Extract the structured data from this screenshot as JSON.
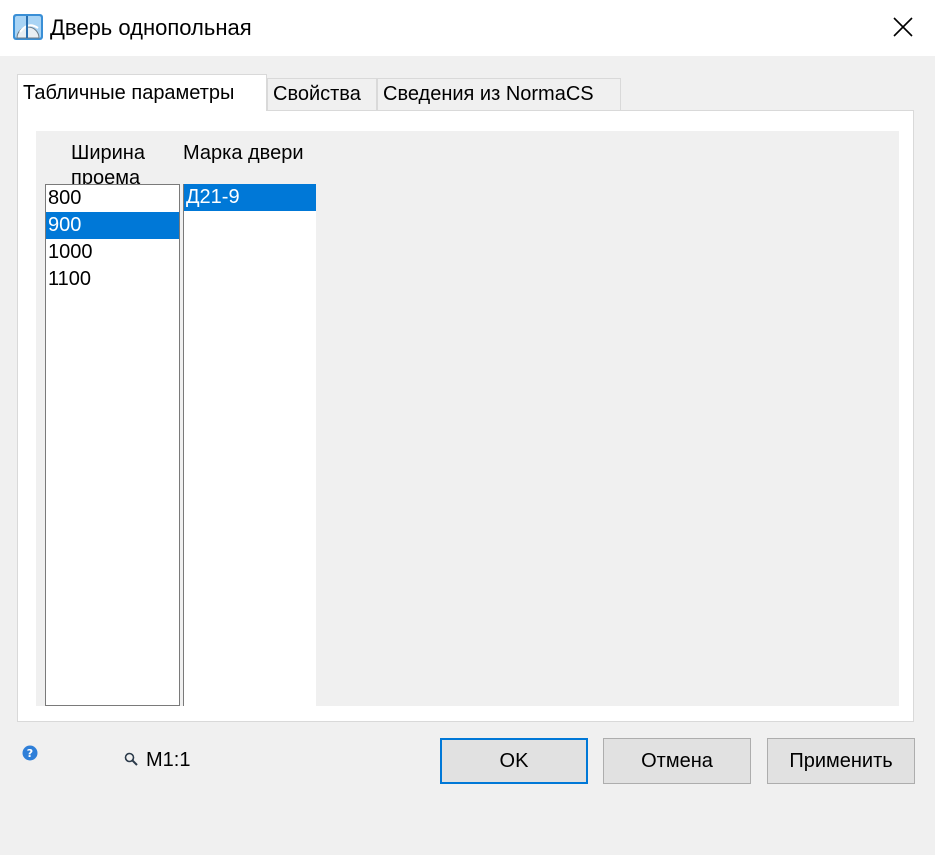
{
  "window": {
    "title": "Дверь однопольная",
    "icon": "door-app-icon"
  },
  "tabs": [
    {
      "label": "Табличные параметры",
      "active": true
    },
    {
      "label": "Свойства",
      "active": false
    },
    {
      "label": "Сведения из NormaCS",
      "active": false
    }
  ],
  "table": {
    "columns": [
      {
        "header": "Ширина проема",
        "items": [
          "800",
          "900",
          "1000",
          "1100"
        ],
        "selected": "900"
      },
      {
        "header": "Марка двери",
        "items": [
          "Д21-9"
        ],
        "selected": "Д21-9"
      }
    ]
  },
  "footer": {
    "help_icon": "help-icon",
    "zoom_icon": "magnifier-icon",
    "scale": "М1:1",
    "ok": "OK",
    "cancel": "Отмена",
    "apply": "Применить"
  },
  "colors": {
    "selection": "#0078d7",
    "default_button_border": "#0078d7",
    "help_icon": "#2f7fd8"
  }
}
